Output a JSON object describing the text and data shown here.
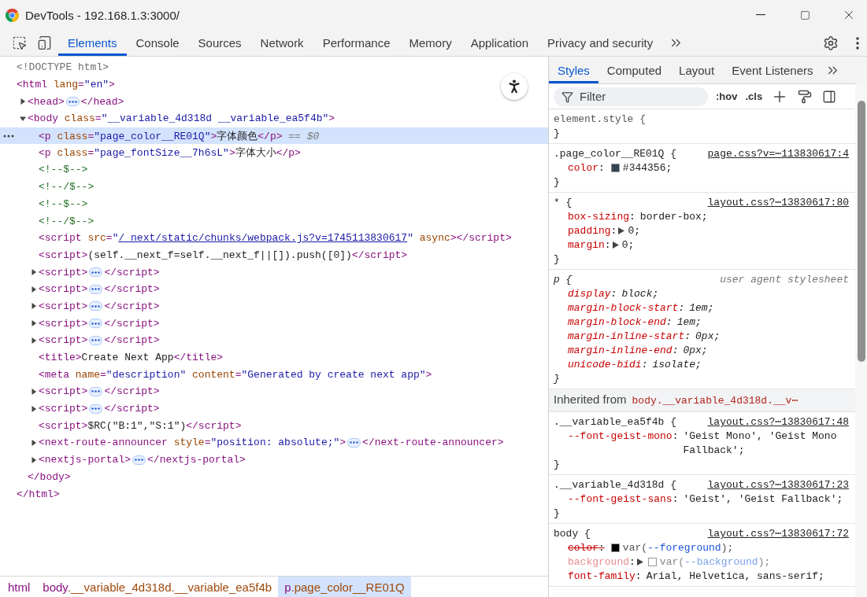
{
  "window": {
    "title": "DevTools - 192.168.1.3:3000/"
  },
  "tabs": [
    {
      "label": "Elements",
      "selected": true
    },
    {
      "label": "Console",
      "selected": false
    },
    {
      "label": "Sources",
      "selected": false
    },
    {
      "label": "Network",
      "selected": false
    },
    {
      "label": "Performance",
      "selected": false
    },
    {
      "label": "Memory",
      "selected": false
    },
    {
      "label": "Application",
      "selected": false
    },
    {
      "label": "Privacy and security",
      "selected": false
    }
  ],
  "dom_tree": [
    {
      "selected": false,
      "head": [
        {
          "kind": "doctype",
          "s": "<!DOCTYPE html>"
        }
      ]
    },
    {
      "selected": false,
      "head": [
        {
          "kind": "tag",
          "s": "<html "
        },
        {
          "kind": "attr",
          "s": "lang"
        },
        {
          "kind": "tag",
          "s": "="
        },
        {
          "kind": "value",
          "s": "\"en\""
        },
        {
          "kind": "tag",
          "s": ">"
        }
      ],
      "tail": [
        {
          "kind": "tag",
          "s": "</html>"
        }
      ],
      "children": [
        {
          "selected": false,
          "expanded": false,
          "head": [
            {
              "kind": "tag",
              "s": "<head>"
            }
          ],
          "tail": [
            {
              "kind": "tag",
              "s": "</head>"
            }
          ]
        },
        {
          "selected": false,
          "expanded": true,
          "head": [
            {
              "kind": "tag",
              "s": "<body "
            },
            {
              "kind": "attr",
              "s": "class"
            },
            {
              "kind": "tag",
              "s": "="
            },
            {
              "kind": "value",
              "s": "\"__variable_4d318d __variable_ea5f4b\""
            },
            {
              "kind": "tag",
              "s": ">"
            }
          ],
          "tail": [
            {
              "kind": "tag",
              "s": "</body>"
            }
          ],
          "children": [
            {
              "selected": true,
              "head": [
                {
                  "kind": "tag",
                  "s": "<p "
                },
                {
                  "kind": "attr",
                  "s": "class"
                },
                {
                  "kind": "tag",
                  "s": "="
                },
                {
                  "kind": "value",
                  "s": "\"page_color__RE01Q\""
                },
                {
                  "kind": "tag",
                  "s": ">"
                },
                {
                  "kind": "text",
                  "s": "字体颜色"
                },
                {
                  "kind": "tag",
                  "s": "</p>"
                },
                {
                  "kind": "hint",
                  "s": " == $0"
                }
              ]
            },
            {
              "selected": false,
              "head": [
                {
                  "kind": "tag",
                  "s": "<p "
                },
                {
                  "kind": "attr",
                  "s": "class"
                },
                {
                  "kind": "tag",
                  "s": "="
                },
                {
                  "kind": "value",
                  "s": "\"page_fontSize__7h6sL\""
                },
                {
                  "kind": "tag",
                  "s": ">"
                },
                {
                  "kind": "text",
                  "s": "字体大小"
                },
                {
                  "kind": "tag",
                  "s": "</p>"
                }
              ]
            },
            {
              "selected": false,
              "head": [
                {
                  "kind": "comment",
                  "s": "<!--$-->"
                }
              ]
            },
            {
              "selected": false,
              "head": [
                {
                  "kind": "comment",
                  "s": "<!--/$-->"
                }
              ]
            },
            {
              "selected": false,
              "head": [
                {
                  "kind": "comment",
                  "s": "<!--$-->"
                }
              ]
            },
            {
              "selected": false,
              "head": [
                {
                  "kind": "comment",
                  "s": "<!--/$-->"
                }
              ]
            },
            {
              "selected": false,
              "head": [
                {
                  "kind": "tag",
                  "s": "<script "
                },
                {
                  "kind": "attr",
                  "s": "src"
                },
                {
                  "kind": "tag",
                  "s": "="
                },
                {
                  "kind": "value",
                  "s": "\""
                },
                {
                  "kind": "link",
                  "s": "/_next/static/chunks/webpack.js?v=1745113830617"
                },
                {
                  "kind": "value",
                  "s": "\""
                },
                {
                  "kind": "attr",
                  "s": " async"
                },
                {
                  "kind": "tag",
                  "s": "></script>"
                }
              ]
            },
            {
              "selected": false,
              "head": [
                {
                  "kind": "tag",
                  "s": "<script>"
                },
                {
                  "kind": "text",
                  "s": "(self.__next_f=self.__next_f||[]).push([0])"
                },
                {
                  "kind": "tag",
                  "s": "</script>"
                }
              ]
            },
            {
              "selected": false,
              "expanded": false,
              "head": [
                {
                  "kind": "tag",
                  "s": "<script>"
                }
              ],
              "tail": [
                {
                  "kind": "tag",
                  "s": "</script>"
                }
              ]
            },
            {
              "selected": false,
              "expanded": false,
              "head": [
                {
                  "kind": "tag",
                  "s": "<script>"
                }
              ],
              "tail": [
                {
                  "kind": "tag",
                  "s": "</script>"
                }
              ]
            },
            {
              "selected": false,
              "expanded": false,
              "head": [
                {
                  "kind": "tag",
                  "s": "<script>"
                }
              ],
              "tail": [
                {
                  "kind": "tag",
                  "s": "</script>"
                }
              ]
            },
            {
              "selected": false,
              "expanded": false,
              "head": [
                {
                  "kind": "tag",
                  "s": "<script>"
                }
              ],
              "tail": [
                {
                  "kind": "tag",
                  "s": "</script>"
                }
              ]
            },
            {
              "selected": false,
              "expanded": false,
              "head": [
                {
                  "kind": "tag",
                  "s": "<script>"
                }
              ],
              "tail": [
                {
                  "kind": "tag",
                  "s": "</script>"
                }
              ]
            },
            {
              "selected": false,
              "head": [
                {
                  "kind": "tag",
                  "s": "<title>"
                },
                {
                  "kind": "text",
                  "s": "Create Next App"
                },
                {
                  "kind": "tag",
                  "s": "</title>"
                }
              ]
            },
            {
              "selected": false,
              "head": [
                {
                  "kind": "tag",
                  "s": "<meta "
                },
                {
                  "kind": "attr",
                  "s": "name"
                },
                {
                  "kind": "tag",
                  "s": "="
                },
                {
                  "kind": "value",
                  "s": "\"description\""
                },
                {
                  "kind": "attr",
                  "s": " content"
                },
                {
                  "kind": "tag",
                  "s": "="
                },
                {
                  "kind": "value",
                  "s": "\"Generated by create next app\""
                },
                {
                  "kind": "tag",
                  "s": ">"
                }
              ]
            },
            {
              "selected": false,
              "expanded": false,
              "head": [
                {
                  "kind": "tag",
                  "s": "<script>"
                }
              ],
              "tail": [
                {
                  "kind": "tag",
                  "s": "</script>"
                }
              ]
            },
            {
              "selected": false,
              "expanded": false,
              "head": [
                {
                  "kind": "tag",
                  "s": "<script>"
                }
              ],
              "tail": [
                {
                  "kind": "tag",
                  "s": "</script>"
                }
              ]
            },
            {
              "selected": false,
              "head": [
                {
                  "kind": "tag",
                  "s": "<script>"
                },
                {
                  "kind": "text",
                  "s": "$RC(\"B:1\",\"S:1\")"
                },
                {
                  "kind": "tag",
                  "s": "</script>"
                }
              ]
            },
            {
              "selected": false,
              "expanded": false,
              "head": [
                {
                  "kind": "tag",
                  "s": "<next-route-announcer "
                },
                {
                  "kind": "attr",
                  "s": "style"
                },
                {
                  "kind": "tag",
                  "s": "="
                },
                {
                  "kind": "value",
                  "s": "\"position: absolute;\""
                },
                {
                  "kind": "tag",
                  "s": ">"
                }
              ],
              "tail": [
                {
                  "kind": "tag",
                  "s": "</next-route-announcer>"
                }
              ]
            },
            {
              "selected": false,
              "expanded": false,
              "head": [
                {
                  "kind": "tag",
                  "s": "<nextjs-portal>"
                }
              ],
              "tail": [
                {
                  "kind": "tag",
                  "s": "</nextjs-portal>"
                }
              ]
            }
          ]
        }
      ]
    }
  ],
  "breadcrumbs": [
    {
      "selected": false,
      "parts": [
        {
          "kind": "tag",
          "s": "html"
        }
      ]
    },
    {
      "selected": false,
      "parts": [
        {
          "kind": "tag",
          "s": "body"
        },
        {
          "kind": "attr",
          "s": ".__variable_4d318d.__variable_ea5f4b"
        }
      ]
    },
    {
      "selected": true,
      "parts": [
        {
          "kind": "tag",
          "s": "p"
        },
        {
          "kind": "attr",
          "s": ".page_color__RE01Q"
        }
      ]
    }
  ],
  "sidebar": {
    "tabs": [
      {
        "label": "Styles",
        "selected": true
      },
      {
        "label": "Computed",
        "selected": false
      },
      {
        "label": "Layout",
        "selected": false
      },
      {
        "label": "Event Listeners",
        "selected": false
      }
    ],
    "filter": {
      "placeholder": "Filter"
    },
    "toggles": [
      ":hov",
      ".cls"
    ],
    "rules": [
      {
        "kind": "inline",
        "selector": "element.style {",
        "close": "}"
      },
      {
        "kind": "author",
        "selector": ".page_color__RE01Q {",
        "source": "page.css?v=⋯113830617:4",
        "close": "}",
        "props": [
          {
            "name": "color",
            "sep": ":",
            "color": "#344356",
            "expandable": false,
            "overridden": false,
            "inactive": false,
            "value": [
              {
                "kind": "plain",
                "s": "#344356;"
              }
            ]
          }
        ]
      },
      {
        "kind": "author",
        "selector": "* {",
        "source": "layout.css?⋯13830617:80",
        "close": "}",
        "props": [
          {
            "name": "box-sizing",
            "sep": ":",
            "expandable": false,
            "overridden": false,
            "inactive": false,
            "value": [
              {
                "kind": "plain",
                "s": "border-box;"
              }
            ]
          },
          {
            "name": "padding",
            "sep": ":",
            "expandable": true,
            "overridden": false,
            "inactive": false,
            "value": [
              {
                "kind": "plain",
                "s": "0;"
              }
            ]
          },
          {
            "name": "margin",
            "sep": ":",
            "expandable": true,
            "overridden": false,
            "inactive": false,
            "value": [
              {
                "kind": "plain",
                "s": "0;"
              }
            ]
          }
        ]
      },
      {
        "kind": "user-agent",
        "selector": "p {",
        "source": "user agent stylesheet",
        "close": "}",
        "props": [
          {
            "name": "display",
            "sep": ":",
            "expandable": false,
            "overridden": false,
            "inactive": false,
            "value": [
              {
                "kind": "plain",
                "s": "block;"
              }
            ]
          },
          {
            "name": "margin-block-start",
            "sep": ":",
            "expandable": false,
            "overridden": false,
            "inactive": false,
            "value": [
              {
                "kind": "plain",
                "s": "1em;"
              }
            ]
          },
          {
            "name": "margin-block-end",
            "sep": ":",
            "expandable": false,
            "overridden": false,
            "inactive": false,
            "value": [
              {
                "kind": "plain",
                "s": "1em;"
              }
            ]
          },
          {
            "name": "margin-inline-start",
            "sep": ":",
            "expandable": false,
            "overridden": false,
            "inactive": false,
            "value": [
              {
                "kind": "plain",
                "s": "0px;"
              }
            ]
          },
          {
            "name": "margin-inline-end",
            "sep": ":",
            "expandable": false,
            "overridden": false,
            "inactive": false,
            "value": [
              {
                "kind": "plain",
                "s": "0px;"
              }
            ]
          },
          {
            "name": "unicode-bidi",
            "sep": ":",
            "expandable": false,
            "overridden": false,
            "inactive": false,
            "value": [
              {
                "kind": "plain",
                "s": "isolate;"
              }
            ]
          }
        ]
      },
      {
        "kind": "inherited",
        "label": "Inherited from",
        "link": "body.__variable_4d318d.__v⋯"
      },
      {
        "kind": "author",
        "selector": ".__variable_ea5f4b {",
        "source": "layout.css?⋯13830617:48",
        "close": "}",
        "props": [
          {
            "name": "--font-geist-mono",
            "sep": ":",
            "expandable": false,
            "overridden": false,
            "inactive": false,
            "value": [
              {
                "kind": "plain",
                "s": "'Geist Mono', 'Geist Mono Fallback';"
              }
            ]
          }
        ]
      },
      {
        "kind": "author",
        "selector": ".__variable_4d318d {",
        "source": "layout.css?⋯13830617:23",
        "close": "}",
        "props": [
          {
            "name": "--font-geist-sans",
            "sep": ":",
            "expandable": false,
            "overridden": false,
            "inactive": false,
            "value": [
              {
                "kind": "plain",
                "s": "'Geist', 'Geist Fallback';"
              }
            ]
          }
        ]
      },
      {
        "kind": "author",
        "selector": "body {",
        "source": "layout.css?⋯13830617:72",
        "props": [
          {
            "name": "color",
            "sep": ":",
            "color": "#000000",
            "expandable": false,
            "overridden": true,
            "inactive": false,
            "value": [
              {
                "kind": "plain",
                "s": "var("
              },
              {
                "kind": "var",
                "s": "--foreground"
              },
              {
                "kind": "plain",
                "s": ");"
              }
            ]
          },
          {
            "name": "background",
            "sep": ":",
            "color": "#ffffff",
            "expandable": true,
            "overridden": false,
            "inactive": true,
            "value": [
              {
                "kind": "plain",
                "s": "var("
              },
              {
                "kind": "var",
                "s": "--background"
              },
              {
                "kind": "plain",
                "s": ");"
              }
            ]
          },
          {
            "name": "font-family",
            "sep": ":",
            "expandable": false,
            "overridden": false,
            "inactive": false,
            "value": [
              {
                "kind": "plain",
                "s": "Arial, Helvetica, sans-serif;"
              }
            ]
          }
        ]
      }
    ]
  }
}
